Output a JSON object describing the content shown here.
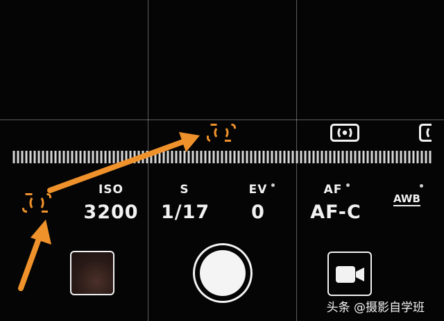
{
  "params": {
    "iso": {
      "label": "ISO",
      "value": "3200"
    },
    "shutter_speed": {
      "label": "S",
      "value": "1/17"
    },
    "ev": {
      "label": "EV",
      "value": "0"
    },
    "af": {
      "label": "AF",
      "value": "AF-C"
    },
    "awb": {
      "label": "AWB"
    }
  },
  "metering_modes": [
    "center-weighted-icon",
    "spot-metering-icon",
    "matrix-metering-icon"
  ],
  "selected_metering": "center-weighted-icon",
  "accent_color": "#f0922b",
  "watermark": "头条 @摄影自学班"
}
